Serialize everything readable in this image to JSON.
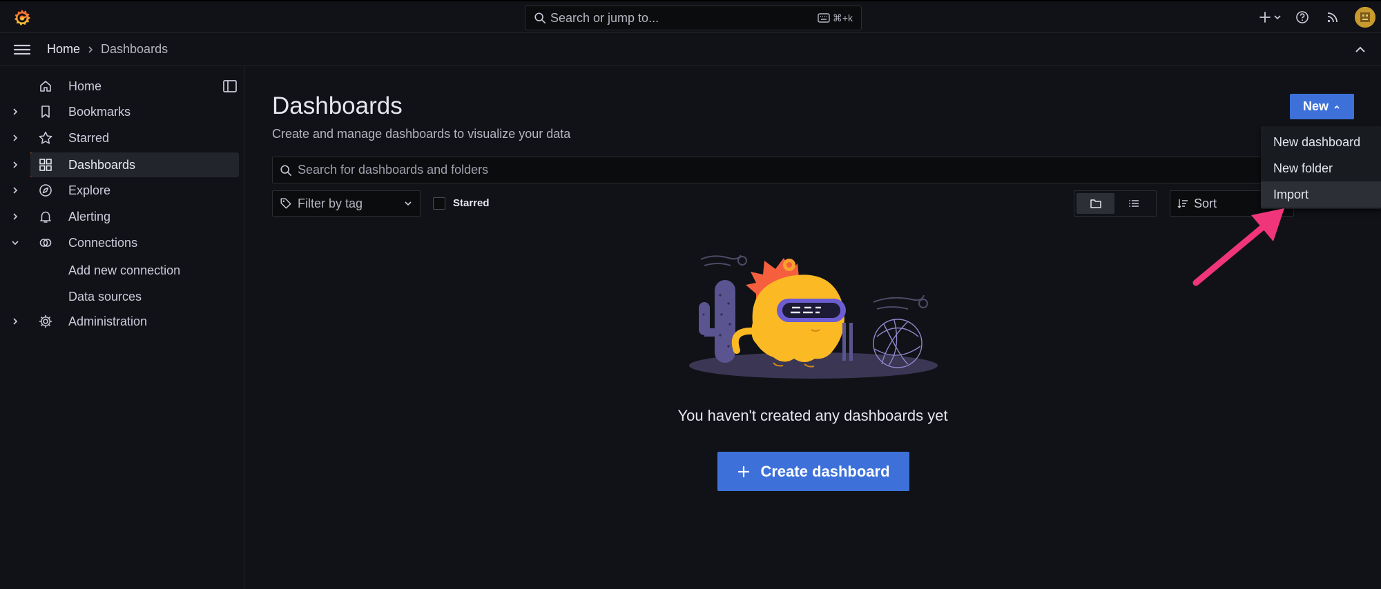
{
  "topbar": {
    "search_placeholder": "Search or jump to...",
    "search_shortcut": "⌘+k"
  },
  "breadcrumb": {
    "home": "Home",
    "current": "Dashboards"
  },
  "sidebar": {
    "items": [
      {
        "label": "Home",
        "icon": "home-icon"
      },
      {
        "label": "Bookmarks",
        "icon": "bookmark-icon"
      },
      {
        "label": "Starred",
        "icon": "star-icon"
      },
      {
        "label": "Dashboards",
        "icon": "apps-icon",
        "active": true
      },
      {
        "label": "Explore",
        "icon": "compass-icon"
      },
      {
        "label": "Alerting",
        "icon": "bell-icon"
      },
      {
        "label": "Connections",
        "icon": "link-icon",
        "expanded": true
      },
      {
        "label": "Administration",
        "icon": "cog-icon"
      }
    ],
    "connections_children": [
      "Add new connection",
      "Data sources"
    ]
  },
  "main": {
    "title": "Dashboards",
    "subtitle": "Create and manage dashboards to visualize your data",
    "new_button": "New",
    "search_placeholder": "Search for dashboards and folders",
    "tag_filter_placeholder": "Filter by tag",
    "starred_label": "Starred",
    "sort_label": "Sort",
    "empty_message": "You haven't created any dashboards yet",
    "create_button": "Create dashboard"
  },
  "new_menu": {
    "items": [
      "New dashboard",
      "New folder",
      "Import"
    ]
  },
  "colors": {
    "background": "#111217",
    "primary": "#3d71d9",
    "accent_orange": "#f55f3e",
    "annotation_arrow": "#f0357a"
  }
}
